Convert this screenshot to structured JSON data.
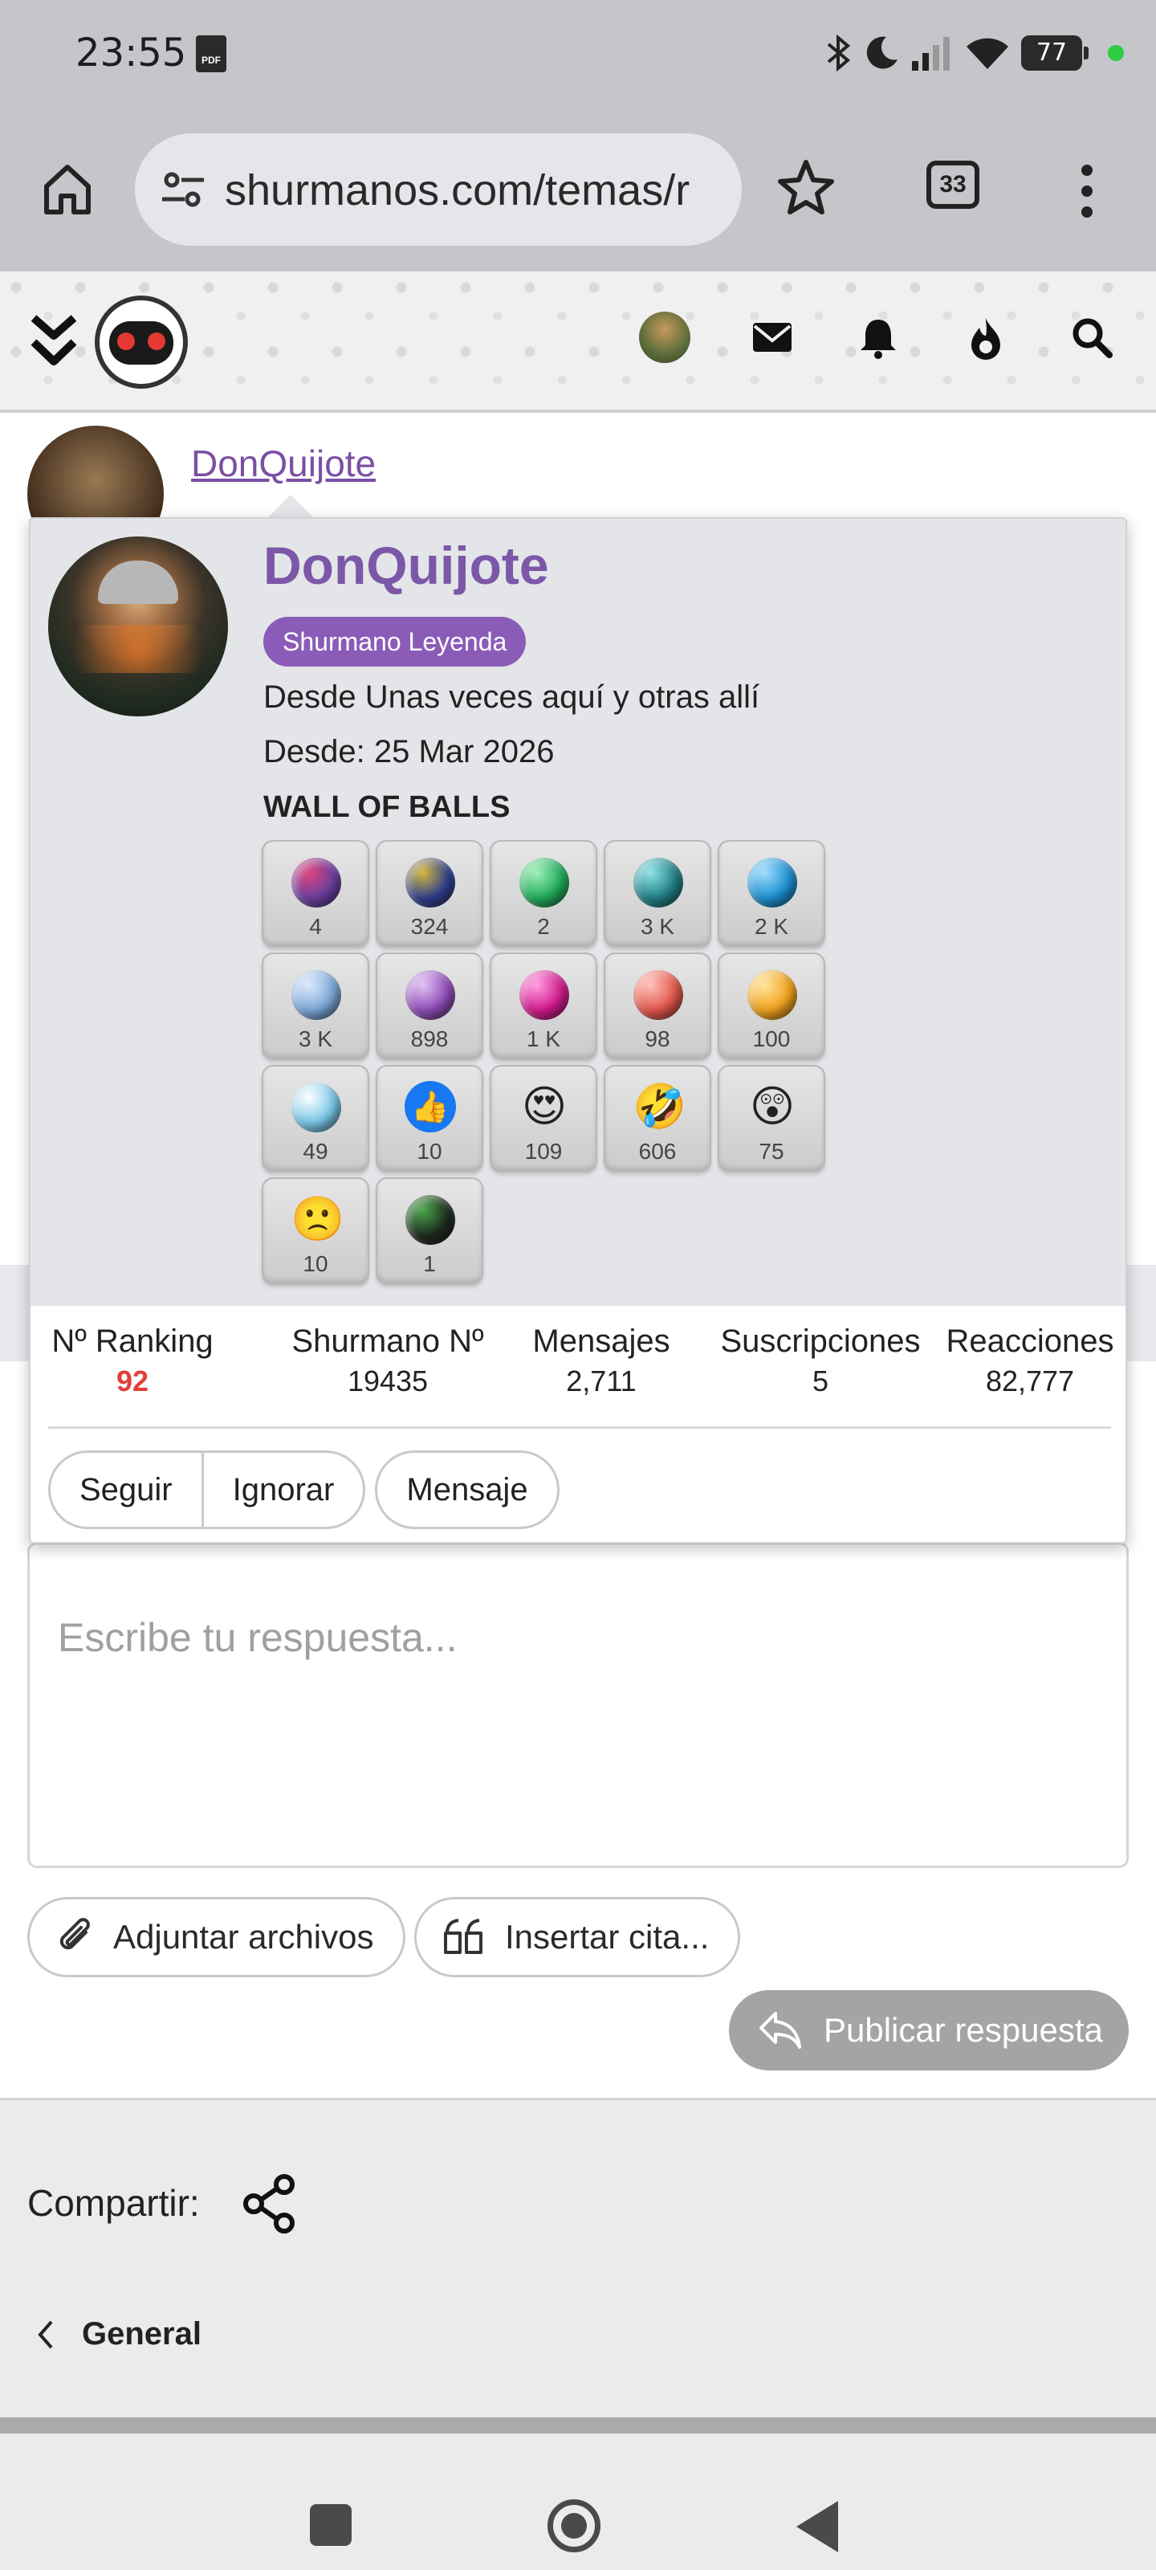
{
  "status_bar": {
    "time": "23:55",
    "battery": "77",
    "pdf_label": "PDF"
  },
  "browser": {
    "url": "shurmanos.com/temas/r",
    "tab_count": "33"
  },
  "post": {
    "username": "DonQuijote"
  },
  "popup": {
    "name": "DonQuijote",
    "badge": "Shurmano Leyenda",
    "location": "Desde Unas veces aquí y otras allí",
    "joined": "Desde: 25 Mar 2026",
    "wall_title": "WALL OF BALLS",
    "balls": [
      {
        "kind": "ball",
        "color": "#6b3fa0",
        "accent": "#e0457b",
        "count": "4"
      },
      {
        "kind": "ball",
        "color": "#2f3f8f",
        "accent": "#d4b83a",
        "count": "324"
      },
      {
        "kind": "ball",
        "color": "#1faa5a",
        "accent": "#9ff0b8",
        "count": "2"
      },
      {
        "kind": "ball",
        "color": "#1f7f84",
        "accent": "#8ee2e6",
        "count": "3 K"
      },
      {
        "kind": "ball",
        "color": "#1b8fd1",
        "accent": "#9fdcff",
        "count": "2 K"
      },
      {
        "kind": "ball",
        "color": "#7aa6d6",
        "accent": "#dceaff",
        "count": "3 K"
      },
      {
        "kind": "ball",
        "color": "#8d4bb5",
        "accent": "#e2c2f5",
        "count": "898"
      },
      {
        "kind": "ball",
        "color": "#d11a8a",
        "accent": "#ff9be0",
        "count": "1 K"
      },
      {
        "kind": "ball",
        "color": "#e2564a",
        "accent": "#ffc0b8",
        "count": "98"
      },
      {
        "kind": "ball",
        "color": "#f0a11c",
        "accent": "#ffe59a",
        "count": "100"
      },
      {
        "kind": "ball",
        "color": "#78c7e8",
        "accent": "#ffffff",
        "count": "49"
      },
      {
        "kind": "emoji",
        "glyph": "👍",
        "bg": "#1877f2",
        "count": "10"
      },
      {
        "kind": "emoji",
        "glyph": "😍",
        "bg": "transparent",
        "count": "109"
      },
      {
        "kind": "emoji",
        "glyph": "🤣",
        "bg": "transparent",
        "count": "606"
      },
      {
        "kind": "emoji",
        "glyph": "😲",
        "bg": "transparent",
        "count": "75"
      },
      {
        "kind": "emoji",
        "glyph": "🙁",
        "bg": "transparent",
        "count": "10"
      },
      {
        "kind": "ball",
        "color": "#1e2a1e",
        "accent": "#4aa84a",
        "count": "1"
      }
    ],
    "stats": [
      {
        "label": "Nº Ranking",
        "value": "92",
        "highlight": true
      },
      {
        "label": "Shurmano Nº",
        "value": "19435",
        "highlight": false
      },
      {
        "label": "Mensajes",
        "value": "2,711",
        "highlight": false
      },
      {
        "label": "Suscripciones",
        "value": "5",
        "highlight": false
      },
      {
        "label": "Reacciones",
        "value": "82,777",
        "highlight": false
      }
    ],
    "actions": {
      "follow": "Seguir",
      "ignore": "Ignorar",
      "message": "Mensaje"
    }
  },
  "editor": {
    "placeholder": "Escribe tu respuesta...",
    "attach_label": "Adjuntar archivos",
    "quote_label": "Insertar cita...",
    "publish_label": "Publicar respuesta"
  },
  "footer": {
    "share_label": "Compartir:",
    "breadcrumb": "General"
  }
}
